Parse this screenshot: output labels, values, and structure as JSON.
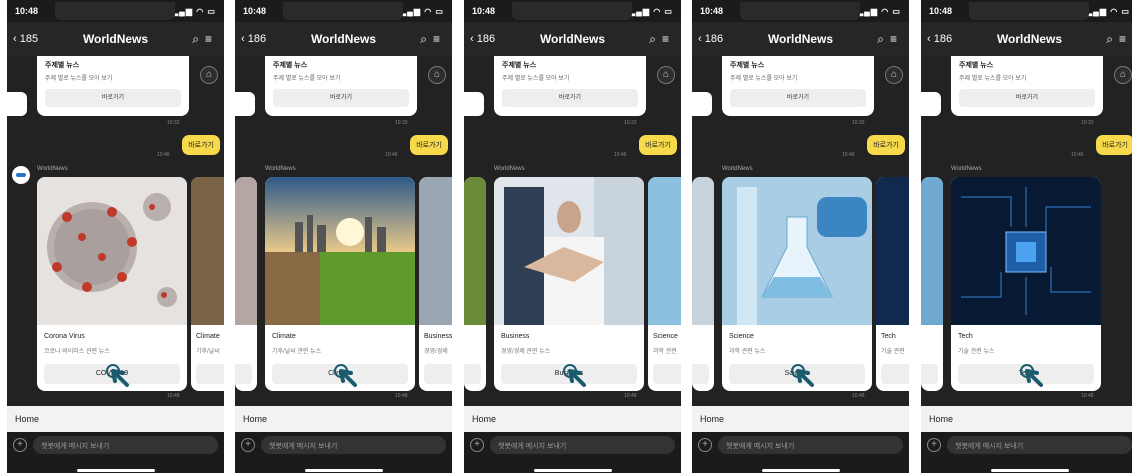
{
  "status": {
    "time": "10:48",
    "icons": "▂▄▆ ◠ ▭"
  },
  "colors": {
    "accent_bubble": "#f7d94c",
    "background": "#222222",
    "card": "#ffffff",
    "cursor": "#1a5b6e"
  },
  "topcard": {
    "title": "주제별 뉴스",
    "subtitle": "주제 별로 뉴스를 모아 보기",
    "button": "바로가기"
  },
  "bubble": "바로가기",
  "timestamp_top": "10:33",
  "timestamp_bubble": "10:46",
  "timestamp_cards": "10:48",
  "sender": "WorldNews",
  "home_label": "Home",
  "input_placeholder": "챗봇에게 메시지 보내기",
  "phones": [
    {
      "back": "185",
      "title": "WorldNews",
      "card": {
        "title": "Corona Virus",
        "subtitle": "코로나 바이러스 관련 뉴스",
        "button": "COVID-19",
        "image": "virus"
      },
      "peek_right": {
        "title": "Climate",
        "subtitle": "기후/날씨"
      }
    },
    {
      "back": "186",
      "title": "WorldNews",
      "card": {
        "title": "Climate",
        "subtitle": "기후/날씨 관련 뉴스",
        "button": "Climate",
        "image": "climate"
      },
      "peek_right": {
        "title": "Business",
        "subtitle": "경영/경제"
      }
    },
    {
      "back": "186",
      "title": "WorldNews",
      "card": {
        "title": "Business",
        "subtitle": "경영/경제 관련 뉴스",
        "button": "Business",
        "image": "business"
      },
      "peek_right": {
        "title": "Science",
        "subtitle": "과학 관련"
      }
    },
    {
      "back": "186",
      "title": "WorldNews",
      "card": {
        "title": "Science",
        "subtitle": "과학 관련 뉴스",
        "button": "Science",
        "image": "science"
      },
      "peek_right": {
        "title": "Tech",
        "subtitle": "기술 관련"
      }
    },
    {
      "back": "186",
      "title": "WorldNews",
      "card": {
        "title": "Tech",
        "subtitle": "기술 관련 뉴스",
        "button": "Tech",
        "image": "tech"
      },
      "peek_right": null
    }
  ]
}
